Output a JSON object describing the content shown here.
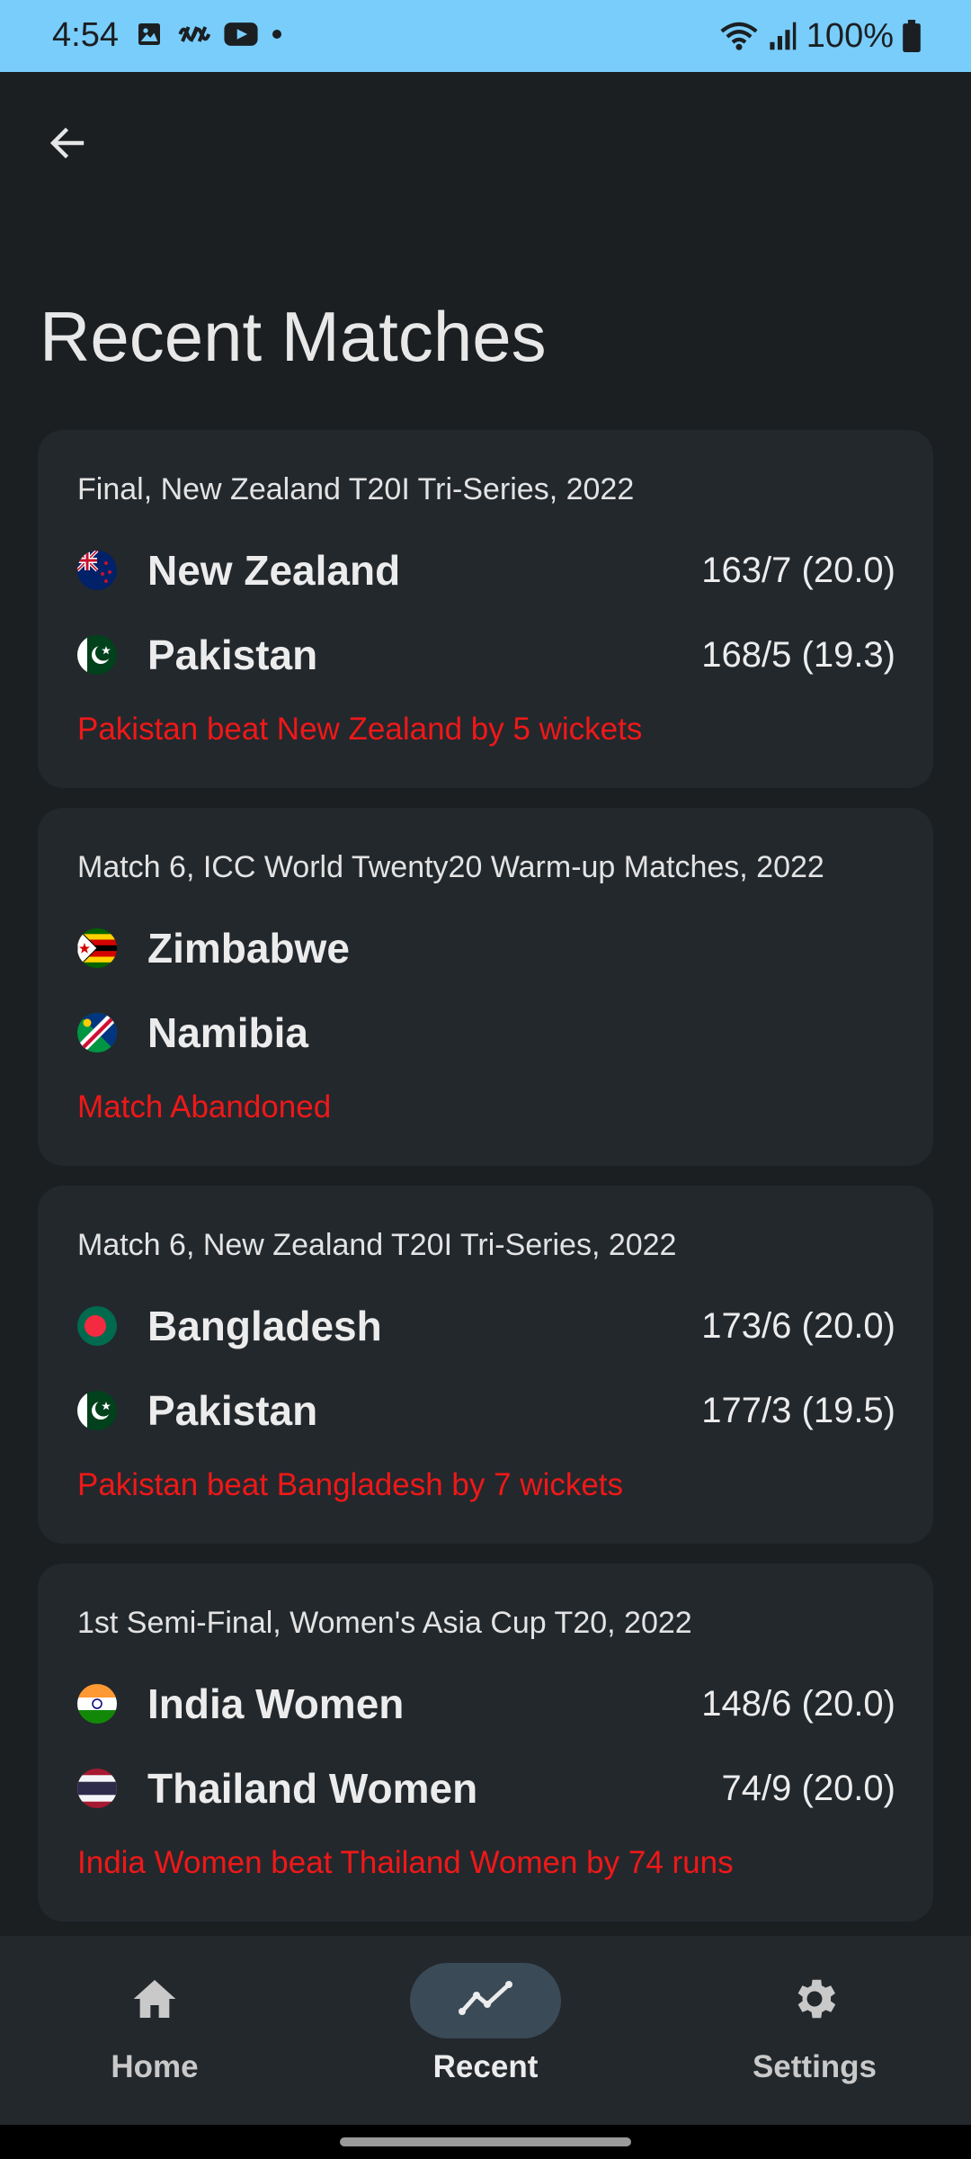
{
  "status_bar": {
    "time": "4:54",
    "battery": "100%",
    "left_icons": [
      "image-icon",
      "audio-wave-icon",
      "youtube-icon",
      "dot-icon"
    ],
    "right_icons": [
      "wifi-icon",
      "signal-icon",
      "battery-icon"
    ]
  },
  "header": {
    "back_icon": "arrow-back-icon"
  },
  "page": {
    "title": "Recent Matches"
  },
  "matches": [
    {
      "series": "Final, New Zealand T20I Tri-Series, 2022",
      "team1": {
        "name": "New Zealand",
        "score": "163/7 (20.0)",
        "flag": "new-zealand-flag"
      },
      "team2": {
        "name": "Pakistan",
        "score": "168/5 (19.3)",
        "flag": "pakistan-flag"
      },
      "result": "Pakistan beat New Zealand by 5 wickets"
    },
    {
      "series": "Match 6, ICC World Twenty20 Warm-up Matches, 2022",
      "team1": {
        "name": "Zimbabwe",
        "score": "",
        "flag": "zimbabwe-flag"
      },
      "team2": {
        "name": "Namibia",
        "score": "",
        "flag": "namibia-flag"
      },
      "result": "Match Abandoned"
    },
    {
      "series": "Match 6, New Zealand T20I Tri-Series, 2022",
      "team1": {
        "name": "Bangladesh",
        "score": "173/6 (20.0)",
        "flag": "bangladesh-flag"
      },
      "team2": {
        "name": "Pakistan",
        "score": "177/3 (19.5)",
        "flag": "pakistan-flag"
      },
      "result": "Pakistan beat Bangladesh by 7 wickets"
    },
    {
      "series": "1st Semi-Final, Women's Asia Cup T20, 2022",
      "team1": {
        "name": "India Women",
        "score": "148/6 (20.0)",
        "flag": "india-flag"
      },
      "team2": {
        "name": "Thailand Women",
        "score": "74/9 (20.0)",
        "flag": "thailand-flag"
      },
      "result": "India Women beat Thailand Women by 74 runs"
    }
  ],
  "nav": {
    "items": [
      {
        "label": "Home",
        "icon": "home-icon"
      },
      {
        "label": "Recent",
        "icon": "trending-icon",
        "active": true
      },
      {
        "label": "Settings",
        "icon": "gear-icon"
      }
    ]
  },
  "colors": {
    "status_bar": "#79cdfb",
    "background": "#1b1f22",
    "card": "#23282d",
    "result": "#f01818",
    "nav_active_pill": "#3a4a56"
  }
}
